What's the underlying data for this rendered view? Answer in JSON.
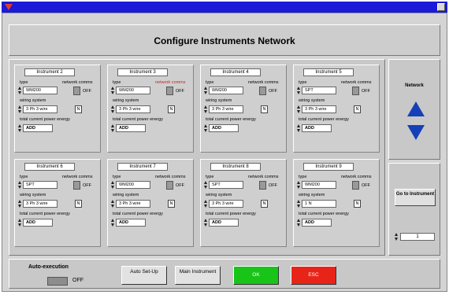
{
  "window": {
    "title": "Configure Instruments Network"
  },
  "instruments": [
    {
      "title": "Instrument 2",
      "type": "WM200",
      "wiring": "3 Ph 3 wire",
      "n": "N",
      "energy": "ADD",
      "comms_red": false
    },
    {
      "title": "Instrument 3",
      "type": "WM200",
      "wiring": "3 Ph 3 wire",
      "n": "N",
      "energy": "ADD",
      "comms_red": true
    },
    {
      "title": "Instrument 4",
      "type": "WM200",
      "wiring": "3 Ph 3 wire",
      "n": "N",
      "energy": "ADD",
      "comms_red": false
    },
    {
      "title": "Instrument 5",
      "type": "SPT",
      "wiring": "3 Ph 3 wire",
      "n": "N",
      "energy": "ADD",
      "comms_red": false
    },
    {
      "title": "Instrument 6",
      "type": "SPT",
      "wiring": "3 Ph 3 wire",
      "n": "N",
      "energy": "ADD",
      "comms_red": false
    },
    {
      "title": "Instrument 7",
      "type": "WM200",
      "wiring": "3 Ph 3 wire",
      "n": "N",
      "energy": "ADD",
      "comms_red": false
    },
    {
      "title": "Instrument 8",
      "type": "SPT",
      "wiring": "3 Ph 3 wire",
      "n": "N",
      "energy": "ADD",
      "comms_red": false
    },
    {
      "title": "Instrument 9",
      "type": "WM200",
      "wiring": "1 N",
      "n": "N",
      "energy": "ADD",
      "comms_red": false
    }
  ],
  "labels": {
    "type": "type",
    "comms": "network comms",
    "wiring": "wiring system",
    "energy": "total current power energy",
    "off": "OFF"
  },
  "network": {
    "label": "Network",
    "goto_label": "Go to Instrument",
    "instrument_number": "1"
  },
  "bottom": {
    "auto_label": "Auto-execution",
    "auto_state": "OFF",
    "auto_setup": "Auto Set-Up",
    "main_instrument": "Main Instrument",
    "ok": "OK",
    "esc": "ESC"
  },
  "colors": {
    "title_bar": "#1a1ad8",
    "arrow": "#1640b8",
    "ok": "#18c418",
    "esc": "#e82418",
    "comms_warning": "#c8261e"
  }
}
